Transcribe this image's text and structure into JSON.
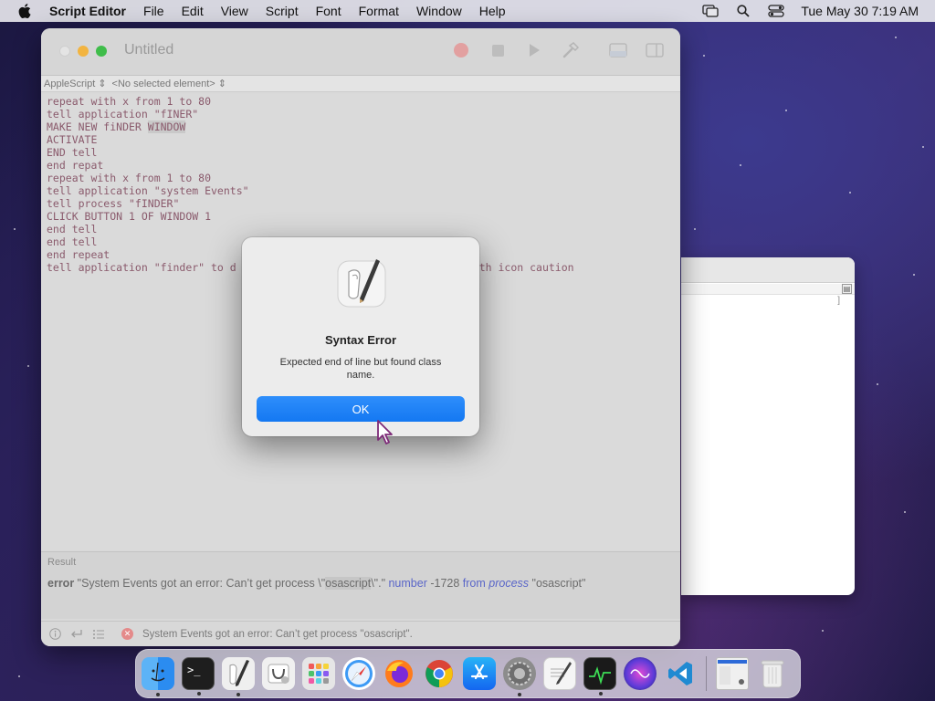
{
  "menubar": {
    "app_name": "Script Editor",
    "items": [
      "File",
      "Edit",
      "View",
      "Script",
      "Font",
      "Format",
      "Window",
      "Help"
    ],
    "clock": "Tue May 30  7:19 AM"
  },
  "window": {
    "title": "Untitled",
    "navbar": {
      "language": "AppleScript",
      "element": "<No selected element>"
    },
    "script_lines": [
      "repeat with x from 1 to 80",
      "tell application \"fINER\"",
      "MAKE NEW fiNDER WINDOW",
      "ACTIVATE",
      "END tell",
      "end repat",
      "repeat with x from 1 to 80",
      "tell application \"system Events\"",
      "tell process \"fINDER\"",
      "CLICK BUTTON 1 OF WINDOW 1",
      "end tell",
      "end tell",
      "end repeat",
      "tell application \"finder\" to d"
    ],
    "script_line_tail": "th icon caution",
    "result_label": "Result",
    "result": {
      "kw": "error",
      "text1": " \"System Events got an error: Can’t get process \\\"",
      "hl": "osascript",
      "text2": "\\\".\" ",
      "number_kw": "number",
      "number": " -1728 ",
      "from_kw": "from",
      "process_kw": "process",
      "process_val": " \"osascript\""
    },
    "status": "System Events got an error: Can’t get process \"osascript\"."
  },
  "dialog": {
    "title": "Syntax Error",
    "message": "Expected end of line but found class name.",
    "ok_label": "OK"
  },
  "dock": {
    "apps": [
      {
        "name": "finder",
        "color": "#2b8cf0",
        "running": true
      },
      {
        "name": "terminal",
        "color": "#1e1e1e",
        "running": true
      },
      {
        "name": "script-editor",
        "color": "#e9e9e9",
        "running": true
      },
      {
        "name": "system-information",
        "color": "#f2f2f2",
        "running": false
      },
      {
        "name": "launchpad",
        "color": "#e8e8e8",
        "running": false
      },
      {
        "name": "safari",
        "color": "#3d9af5",
        "running": false
      },
      {
        "name": "firefox",
        "color": "#ff7b1c",
        "running": false
      },
      {
        "name": "chrome",
        "color": "#ffffff",
        "running": false
      },
      {
        "name": "app-store",
        "color": "#1c8cf5",
        "running": false
      },
      {
        "name": "system-preferences",
        "color": "#8c8c8c",
        "running": true
      },
      {
        "name": "textedit",
        "color": "#f5f5f5",
        "running": false
      },
      {
        "name": "activity-monitor",
        "color": "#1a1a1a",
        "running": true
      },
      {
        "name": "siri",
        "color": "#6b3fd1",
        "running": false
      },
      {
        "name": "vscode",
        "color": "#ffffff",
        "running": false
      },
      {
        "name": "preview-window",
        "color": "#f0f0f0",
        "running": false
      },
      {
        "name": "trash",
        "color": "#e8e8e8",
        "running": false
      }
    ]
  }
}
